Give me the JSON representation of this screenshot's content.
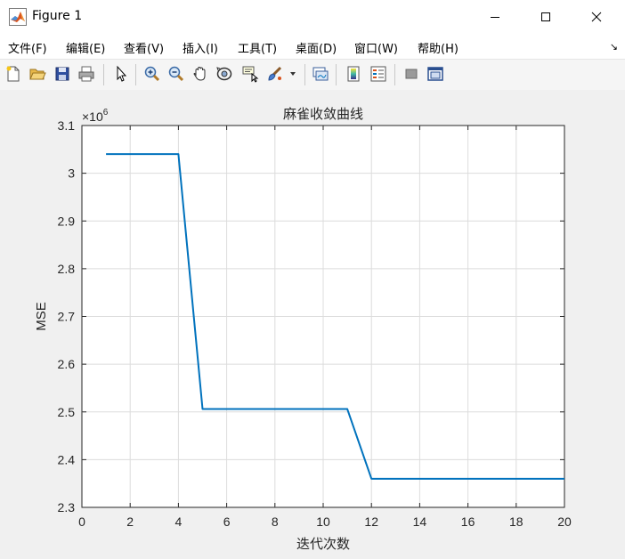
{
  "window": {
    "title": "Figure 1"
  },
  "menu": {
    "items": [
      {
        "label": "文件(F)"
      },
      {
        "label": "编辑(E)"
      },
      {
        "label": "查看(V)"
      },
      {
        "label": "插入(I)"
      },
      {
        "label": "工具(T)"
      },
      {
        "label": "桌面(D)"
      },
      {
        "label": "窗口(W)"
      },
      {
        "label": "帮助(H)"
      }
    ],
    "overflow_glyph": "↘"
  },
  "toolbar": {
    "tools": [
      "new-figure",
      "open-file",
      "save",
      "print",
      "select",
      "zoom-in",
      "zoom-out",
      "pan",
      "rotate-3d",
      "data-cursor",
      "brush",
      "link-plot",
      "colorbar",
      "legend",
      "hide-plot-tools",
      "show-plot-tools"
    ]
  },
  "colors": {
    "line": "#0072bd",
    "grid": "#dcdcdc",
    "axes_bg": "#ffffff",
    "figure_bg": "#f0f0f0"
  },
  "chart_data": {
    "type": "line",
    "title": "麻雀收敛曲线",
    "xlabel": "迭代次数",
    "ylabel": "MSE",
    "exponent_label": "×10",
    "exponent_power": "6",
    "xlim": [
      0,
      20
    ],
    "ylim": [
      2.3,
      3.1
    ],
    "xticks": [
      0,
      2,
      4,
      6,
      8,
      10,
      12,
      14,
      16,
      18,
      20
    ],
    "yticks": [
      2.3,
      2.4,
      2.5,
      2.6,
      2.7,
      2.8,
      2.9,
      3.0,
      3.1
    ],
    "ytick_labels": [
      "2.3",
      "2.4",
      "2.5",
      "2.6",
      "2.7",
      "2.8",
      "2.9",
      "3",
      "3.1"
    ],
    "grid": true,
    "series": [
      {
        "x": [
          1,
          2,
          3,
          4,
          5,
          6,
          7,
          8,
          9,
          10,
          11,
          12,
          13,
          14,
          15,
          16,
          17,
          18,
          19,
          20
        ],
        "values": [
          3.04,
          3.04,
          3.04,
          3.04,
          2.506,
          2.506,
          2.506,
          2.506,
          2.506,
          2.506,
          2.506,
          2.36,
          2.36,
          2.36,
          2.36,
          2.36,
          2.36,
          2.36,
          2.36,
          2.36
        ]
      }
    ]
  }
}
